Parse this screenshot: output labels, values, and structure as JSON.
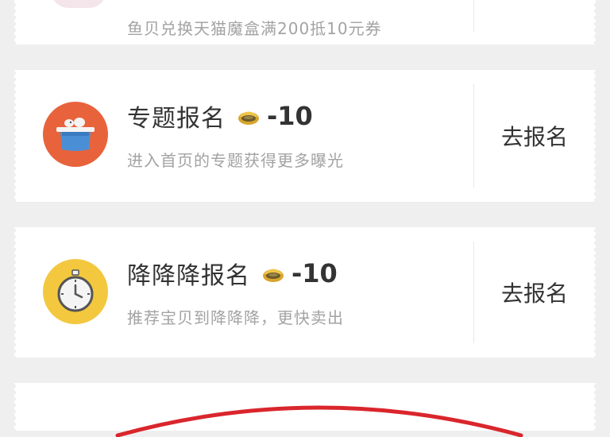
{
  "top_card": {
    "description": "鱼贝兑换天猫魔盒满200抵10元券"
  },
  "cards": [
    {
      "title": "专题报名",
      "cost": "-10",
      "description": "进入首页的专题获得更多曝光",
      "action": "去报名",
      "icon": "hat-icon",
      "icon_color": "#e8633b"
    },
    {
      "title": "降降降报名",
      "cost": "-10",
      "description": "推荐宝贝到降降降，更快卖出",
      "action": "去报名",
      "icon": "stopwatch-icon",
      "icon_color": "#f3c83f"
    }
  ],
  "coin_icon": "fish-shell-coin-icon",
  "colors": {
    "background": "#efefef",
    "card": "#ffffff",
    "text": "#333333",
    "subtext": "#a3a3a3",
    "accent_red": "#d9262c"
  }
}
